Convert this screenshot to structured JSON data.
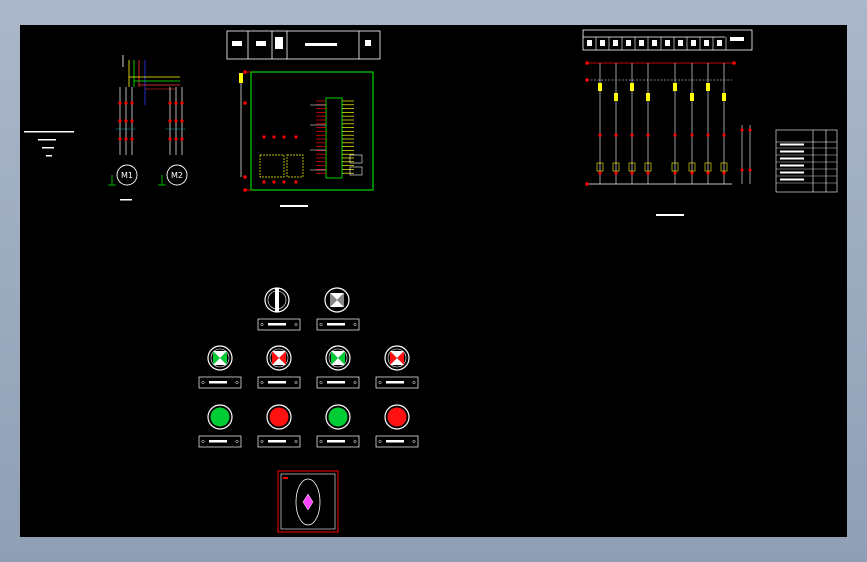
{
  "motor_labels": [
    "M1",
    "M2"
  ],
  "colors": {
    "background": "#000000",
    "wire": "#ffffff",
    "frame": "#00ff00",
    "terminal": "#ff0000",
    "component": "#ffff00",
    "green_lamp": "#00cc33",
    "red_lamp": "#ff1111",
    "magenta": "#ff44ff"
  },
  "panel": {
    "row1": [
      {
        "icon": "selector-switch-icon"
      },
      {
        "icon": "indicator-lamp-icon"
      }
    ],
    "row2": [
      {
        "icon": "green-indicator-lamp-icon"
      },
      {
        "icon": "red-indicator-lamp-icon"
      },
      {
        "icon": "green-indicator-lamp-icon"
      },
      {
        "icon": "red-indicator-lamp-icon"
      }
    ],
    "row3": [
      {
        "icon": "green-push-button-icon"
      },
      {
        "icon": "red-push-button-icon"
      },
      {
        "icon": "green-push-button-icon"
      },
      {
        "icon": "red-push-button-icon"
      }
    ]
  }
}
